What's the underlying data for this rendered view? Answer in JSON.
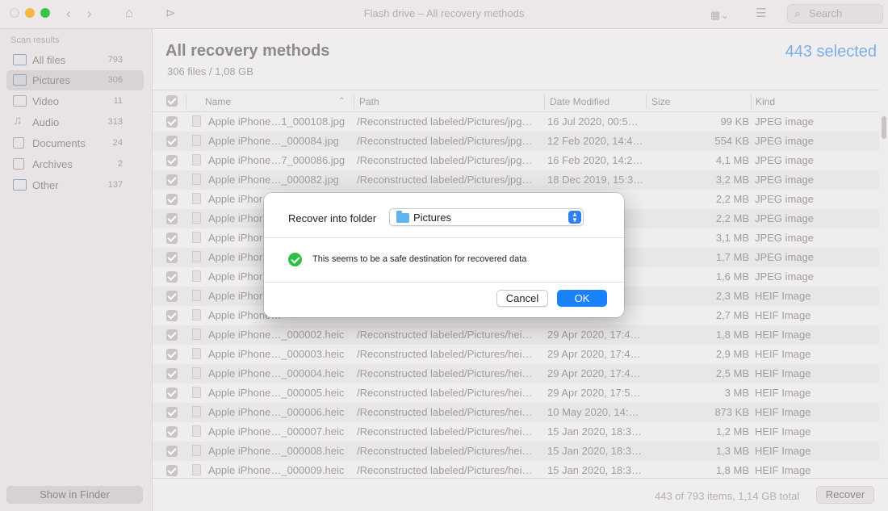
{
  "window": {
    "title": "Flash drive – All recovery methods",
    "search_placeholder": "Search"
  },
  "sidebar": {
    "heading": "Scan results",
    "items": [
      {
        "label": "All files",
        "count": "793"
      },
      {
        "label": "Pictures",
        "count": "306"
      },
      {
        "label": "Video",
        "count": "11"
      },
      {
        "label": "Audio",
        "count": "313"
      },
      {
        "label": "Documents",
        "count": "24"
      },
      {
        "label": "Archives",
        "count": "2"
      },
      {
        "label": "Other",
        "count": "137"
      }
    ],
    "show_in_finder": "Show in Finder"
  },
  "main": {
    "title": "All recovery methods",
    "subtitle": "306 files / 1,08 GB",
    "selected": "443 selected",
    "columns": {
      "name": "Name",
      "path": "Path",
      "date": "Date Modified",
      "size": "Size",
      "kind": "Kind"
    },
    "rows": [
      {
        "name": "Apple iPhone…1_000108.jpg",
        "path": "/Reconstructed labeled/Pictures/jpg…",
        "date": "16 Jul 2020, 00:5…",
        "size": "99 KB",
        "kind": "JPEG image"
      },
      {
        "name": "Apple iPhone…_000084.jpg",
        "path": "/Reconstructed labeled/Pictures/jpg…",
        "date": "12 Feb 2020, 14:4…",
        "size": "554 KB",
        "kind": "JPEG image"
      },
      {
        "name": "Apple iPhone…7_000086.jpg",
        "path": "/Reconstructed labeled/Pictures/jpg…",
        "date": "16 Feb 2020, 14:2…",
        "size": "4,1 MB",
        "kind": "JPEG image"
      },
      {
        "name": "Apple iPhone…_000082.jpg",
        "path": "/Reconstructed labeled/Pictures/jpg…",
        "date": "18 Dec 2019, 15:3…",
        "size": "3,2 MB",
        "kind": "JPEG image"
      },
      {
        "name": "Apple iPhor",
        "path": "",
        "date": "",
        "size": "2,2 MB",
        "kind": "JPEG image"
      },
      {
        "name": "Apple iPhor",
        "path": "",
        "date": "",
        "size": "2,2 MB",
        "kind": "JPEG image"
      },
      {
        "name": "Apple iPhor",
        "path": "",
        "date": "",
        "size": "3,1 MB",
        "kind": "JPEG image"
      },
      {
        "name": "Apple iPhor",
        "path": "",
        "date": "",
        "size": "1,7 MB",
        "kind": "JPEG image"
      },
      {
        "name": "Apple iPhor",
        "path": "",
        "date": "",
        "size": "1,6 MB",
        "kind": "JPEG image"
      },
      {
        "name": "Apple iPhor",
        "path": "",
        "date": "",
        "size": "2,3 MB",
        "kind": "HEIF Image"
      },
      {
        "name": "Apple iPhone…",
        "path": "",
        "date": "",
        "size": "2,7 MB",
        "kind": "HEIF Image"
      },
      {
        "name": "Apple iPhone…_000002.heic",
        "path": "/Reconstructed labeled/Pictures/hei…",
        "date": "29 Apr 2020, 17:4…",
        "size": "1,8 MB",
        "kind": "HEIF Image"
      },
      {
        "name": "Apple iPhone…_000003.heic",
        "path": "/Reconstructed labeled/Pictures/hei…",
        "date": "29 Apr 2020, 17:4…",
        "size": "2,9 MB",
        "kind": "HEIF Image"
      },
      {
        "name": "Apple iPhone…_000004.heic",
        "path": "/Reconstructed labeled/Pictures/hei…",
        "date": "29 Apr 2020, 17:4…",
        "size": "2,5 MB",
        "kind": "HEIF Image"
      },
      {
        "name": "Apple iPhone…_000005.heic",
        "path": "/Reconstructed labeled/Pictures/hei…",
        "date": "29 Apr 2020, 17:5…",
        "size": "3 MB",
        "kind": "HEIF Image"
      },
      {
        "name": "Apple iPhone…_000006.heic",
        "path": "/Reconstructed labeled/Pictures/hei…",
        "date": "10 May 2020, 14:…",
        "size": "873 KB",
        "kind": "HEIF Image"
      },
      {
        "name": "Apple iPhone…_000007.heic",
        "path": "/Reconstructed labeled/Pictures/hei…",
        "date": "15 Jan 2020, 18:3…",
        "size": "1,2 MB",
        "kind": "HEIF Image"
      },
      {
        "name": "Apple iPhone…_000008.heic",
        "path": "/Reconstructed labeled/Pictures/hei…",
        "date": "15 Jan 2020, 18:3…",
        "size": "1,3 MB",
        "kind": "HEIF Image"
      },
      {
        "name": "Apple iPhone…_000009.heic",
        "path": "/Reconstructed labeled/Pictures/hei…",
        "date": "15 Jan 2020, 18:3…",
        "size": "1,8 MB",
        "kind": "HEIF Image"
      }
    ],
    "footer_info": "443 of 793 items, 1,14 GB total",
    "recover_label": "Recover"
  },
  "dialog": {
    "label": "Recover into folder",
    "folder": "Pictures",
    "message": "This seems to be a safe destination for recovered data",
    "cancel": "Cancel",
    "ok": "OK"
  }
}
